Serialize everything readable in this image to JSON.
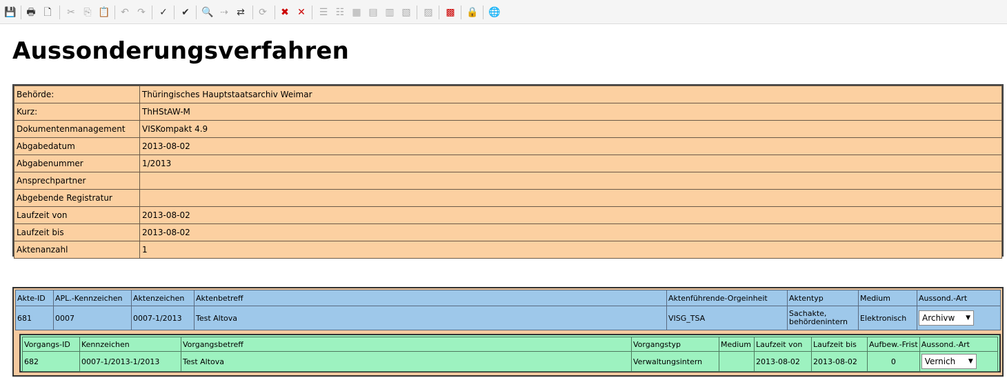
{
  "toolbar": {
    "items": [
      {
        "icon": "save-icon",
        "glyph": "💾"
      },
      {
        "icon": "print-icon",
        "glyph": "🖶"
      },
      {
        "icon": "print-preview-icon",
        "glyph": "🗋"
      },
      {
        "icon": "cut-icon",
        "glyph": "✂"
      },
      {
        "icon": "copy-icon",
        "glyph": "⎘"
      },
      {
        "icon": "paste-icon",
        "glyph": "📋"
      },
      {
        "icon": "undo-icon",
        "glyph": "↶"
      },
      {
        "icon": "redo-icon",
        "glyph": "↷"
      },
      {
        "icon": "validate-icon",
        "glyph": "✓"
      },
      {
        "icon": "spellcheck-icon",
        "glyph": "✔"
      },
      {
        "icon": "find-icon",
        "glyph": "🔍"
      },
      {
        "icon": "find-next-icon",
        "glyph": "⇢"
      },
      {
        "icon": "replace-icon",
        "glyph": "⇄"
      },
      {
        "icon": "refresh-icon",
        "glyph": "⟳"
      },
      {
        "icon": "delete-row-icon",
        "glyph": "✖"
      },
      {
        "icon": "delete-col-icon",
        "glyph": "✕"
      },
      {
        "icon": "insert-row-icon",
        "glyph": "☰"
      },
      {
        "icon": "append-row-icon",
        "glyph": "☷"
      },
      {
        "icon": "insert-table-icon",
        "glyph": "▦"
      },
      {
        "icon": "table-icon",
        "glyph": "▤"
      },
      {
        "icon": "table-props-icon",
        "glyph": "▥"
      },
      {
        "icon": "table-split-icon",
        "glyph": "▧"
      },
      {
        "icon": "layout-icon",
        "glyph": "▨"
      },
      {
        "icon": "pdf-icon",
        "glyph": "▩"
      },
      {
        "icon": "lock-icon",
        "glyph": "🔒"
      },
      {
        "icon": "globe-icon",
        "glyph": "🌐"
      }
    ]
  },
  "page": {
    "title": "Aussonderungsverfahren"
  },
  "info": {
    "rows": [
      {
        "label": "Behörde:",
        "value": "Thüringisches Hauptstaatsarchiv Weimar"
      },
      {
        "label": "Kurz:",
        "value": "ThHStAW-M"
      },
      {
        "label": "Dokumentenmanagement",
        "value": "VISKompakt 4.9"
      },
      {
        "label": "Abgabedatum",
        "value": "2013-08-02"
      },
      {
        "label": "Abgabenummer",
        "value": "1/2013"
      },
      {
        "label": "Ansprechpartner",
        "value": ""
      },
      {
        "label": "Abgebende Registratur",
        "value": ""
      },
      {
        "label": "Laufzeit von",
        "value": "2013-08-02"
      },
      {
        "label": "Laufzeit bis",
        "value": "2013-08-02"
      },
      {
        "label": "Aktenanzahl",
        "value": "1"
      }
    ]
  },
  "akte": {
    "headers": [
      "Akte-ID",
      "APL.-Kennzeichen",
      "Aktenzeichen",
      "Aktenbetreff",
      "Aktenführende-Orgeinheit",
      "Aktentyp",
      "Medium",
      "Aussond.-Art"
    ],
    "row": {
      "akte_id": "681",
      "apl": "0007",
      "aktenzeichen": "0007-1/2013",
      "betreff": "Test Altova",
      "orgeinheit": "VISG_TSA",
      "aktentyp": "Sachakte, behördenintern",
      "medium": "Elektronisch",
      "aussond": "Archivw"
    }
  },
  "vorgang": {
    "headers": [
      "Vorgangs-ID",
      "Kennzeichen",
      "Vorgangsbetreff",
      "Vorgangstyp",
      "Medium",
      "Laufzeit von",
      "Laufzeit bis",
      "Aufbew.-Frist",
      "Aussond.-Art"
    ],
    "row": {
      "id": "682",
      "kennzeichen": "0007-1/2013-1/2013",
      "betreff": "Test Altova",
      "typ": "Verwaltungsintern",
      "medium": "",
      "von": "2013-08-02",
      "bis": "2013-08-02",
      "frist": "0",
      "aussond": "Vernich"
    }
  }
}
